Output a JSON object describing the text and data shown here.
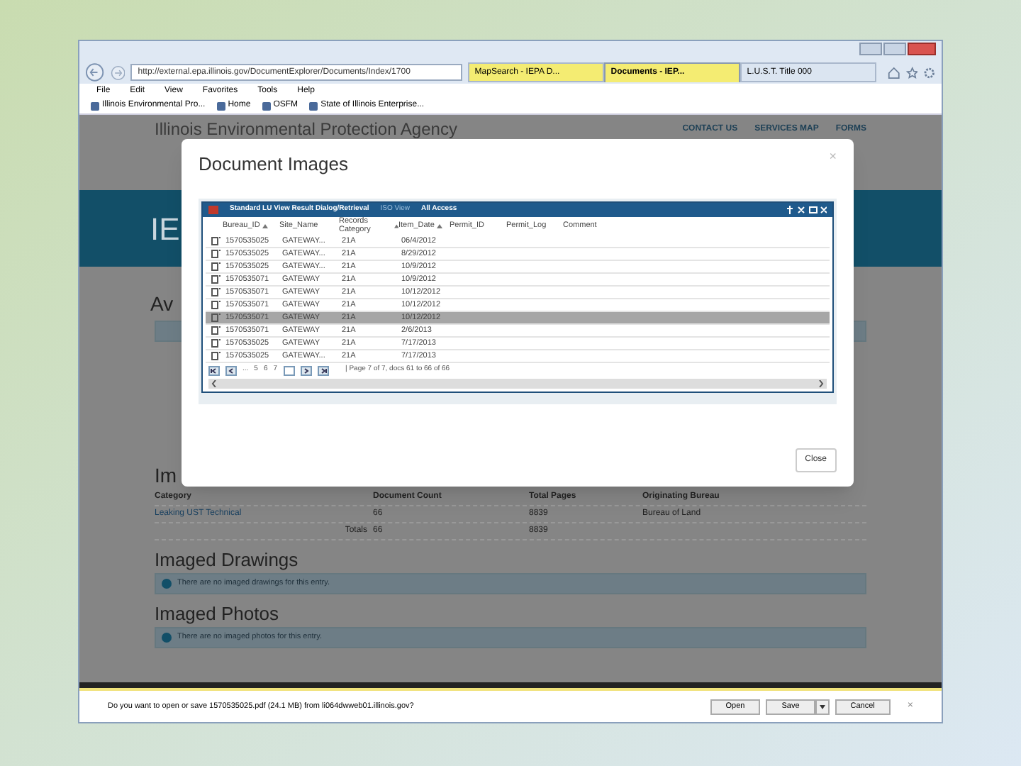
{
  "browser": {
    "address": "http://external.epa.illinois.gov/DocumentExplorer/Documents/Index/1700",
    "tabs": [
      {
        "label": "MapSearch - IEPA D...",
        "selected": false,
        "color": "#f4ec72"
      },
      {
        "label": "Documents - IEP...",
        "selected": true,
        "color": "#f4ec72"
      },
      {
        "label": "L.U.S.T. Title 000",
        "selected": false,
        "color": "#dbe5f1"
      }
    ],
    "menu": [
      "File",
      "Edit",
      "View",
      "Favorites",
      "Tools",
      "Help"
    ],
    "favorites": [
      "Illinois Environmental Pro...",
      "Home",
      "OSFM",
      "State of Illinois Enterprise..."
    ]
  },
  "site": {
    "agency": "Illinois Environmental Protection Agency",
    "links": [
      "CONTACT US",
      "SERVICES MAP",
      "FORMS"
    ],
    "banner_text": "IE",
    "heading_1": "Av",
    "heading_2": "Im",
    "summary_table": {
      "columns": [
        "Category",
        "Document Count",
        "Total Pages",
        "Originating Bureau"
      ],
      "rows": [
        [
          "Leaking UST Technical",
          "66",
          "8839",
          "Bureau of Land"
        ]
      ],
      "totals": {
        "label": "Totals",
        "document_count": "66",
        "total_pages": "8839"
      }
    },
    "sections": [
      {
        "title": "Imaged Drawings",
        "message": "There are no imaged drawings for this entry."
      },
      {
        "title": "Imaged Photos",
        "message": "There are no imaged photos for this entry."
      }
    ]
  },
  "modal": {
    "title": "Document Images",
    "close": "×",
    "grid": {
      "title": "Standard LU View Result Dialog/Retrieval",
      "subtitle": "ISO View",
      "access": "All Access",
      "columns": [
        {
          "label": "Bureau_ID",
          "sorted": true
        },
        {
          "label": "Site_Name",
          "sorted": false
        },
        {
          "label": "Records Category",
          "sorted": true
        },
        {
          "label": "Item_Date",
          "sorted": true
        },
        {
          "label": "Permit_ID",
          "sorted": false
        },
        {
          "label": "Permit_Log",
          "sorted": false
        },
        {
          "label": "Comment",
          "sorted": false
        }
      ],
      "rows": [
        {
          "cells": [
            "1570535025",
            "GATEWAY...",
            "21A",
            "06/4/2012"
          ],
          "selected": false
        },
        {
          "cells": [
            "1570535025",
            "GATEWAY...",
            "21A",
            "8/29/2012"
          ],
          "selected": false
        },
        {
          "cells": [
            "1570535025",
            "GATEWAY...",
            "21A",
            "10/9/2012"
          ],
          "selected": false
        },
        {
          "cells": [
            "1570535071",
            "GATEWAY",
            "21A",
            "10/9/2012"
          ],
          "selected": false
        },
        {
          "cells": [
            "1570535071",
            "GATEWAY",
            "21A",
            "10/12/2012"
          ],
          "selected": false
        },
        {
          "cells": [
            "1570535071",
            "GATEWAY",
            "21A",
            "10/12/2012"
          ],
          "selected": false
        },
        {
          "cells": [
            "1570535071",
            "GATEWAY",
            "21A",
            "10/12/2012"
          ],
          "selected": true
        },
        {
          "cells": [
            "1570535071",
            "GATEWAY",
            "21A",
            "2/6/2013"
          ],
          "selected": false
        },
        {
          "cells": [
            "1570535025",
            "GATEWAY",
            "21A",
            "7/17/2013"
          ],
          "selected": false
        },
        {
          "cells": [
            "1570535025",
            "GATEWAY...",
            "21A",
            "7/17/2013"
          ],
          "selected": false
        }
      ],
      "pager": {
        "pages": [
          "...",
          "5",
          "6",
          "7"
        ],
        "status": "| Page 7 of 7, docs 61 to 66 of 66"
      }
    },
    "close_button": "Close"
  },
  "download_bar": {
    "message": "Do you want to open or save 1570535025.pdf (24.1 MB) from li064dwweb01.illinois.gov?",
    "buttons": [
      "Open",
      "Save",
      "Cancel"
    ],
    "close": "×"
  }
}
